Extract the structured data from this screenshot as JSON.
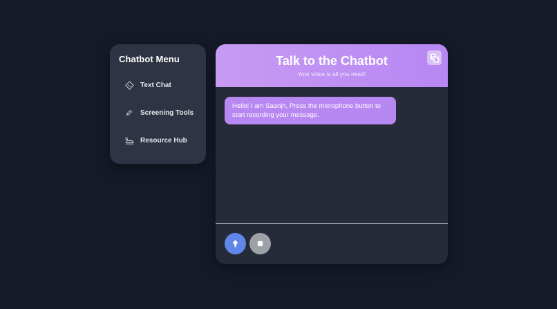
{
  "menu": {
    "title": "Chatbot Menu",
    "items": [
      {
        "label": "Text Chat",
        "icon": "tag-icon"
      },
      {
        "label": "Screening Tools",
        "icon": "pin-icon"
      },
      {
        "label": "Resource Hub",
        "icon": "ship-icon"
      }
    ]
  },
  "chat": {
    "title": "Talk to the Chatbot",
    "subtitle": "Your voice is all you need!",
    "translate_icon": "translate-icon",
    "messages": [
      {
        "sender": "bot",
        "text": "Hello! I am Saanjh, Press the microphone button to start recording your message."
      }
    ],
    "controls": {
      "record_icon": "microphone-icon",
      "stop_icon": "stop-icon"
    }
  },
  "colors": {
    "background": "#151a28",
    "panel": "#2e3443",
    "chat_body": "#252b38",
    "header_accent": "#b787f3",
    "bubble": "#b888f2",
    "record_button": "#5f86e8",
    "stop_button": "#9ea1a7"
  }
}
